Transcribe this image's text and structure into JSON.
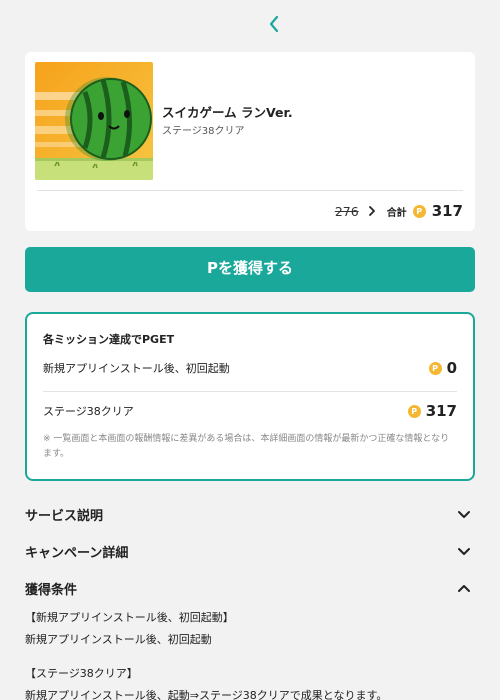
{
  "nav": {
    "back_icon": "chevron-left-icon"
  },
  "app": {
    "name": "スイカゲーム ランVer.",
    "subtitle": "ステージ38クリア",
    "old_points": "276",
    "total_label": "合計",
    "coin_glyph": "P",
    "total_points": "317"
  },
  "get_button": {
    "label": "Pを獲得する"
  },
  "missions": {
    "title": "各ミッション達成でPGET",
    "items": [
      {
        "label": "新規アプリインストール後、初回起動",
        "points": "0"
      },
      {
        "label": "ステージ38クリア",
        "points": "317"
      }
    ],
    "note": "※ 一覧画面と本画面の報酬情報に差異がある場合は、本詳細画面の情報が最新かつ正確な情報となります。"
  },
  "accordions": [
    {
      "title": "サービス説明",
      "state": "collapsed"
    },
    {
      "title": "キャンペーン詳細",
      "state": "collapsed"
    },
    {
      "title": "獲得条件",
      "state": "expanded"
    }
  ],
  "conditions": {
    "heading1": "【新規アプリインストール後、初回起動】",
    "text1": "新規アプリインストール後、初回起動",
    "heading2": "【ステージ38クリア】",
    "text2": "新規アプリインストール後、起動⇒ステージ38クリアで成果となります。"
  },
  "colors": {
    "accent": "#1aa89b",
    "coin": "#f5b731",
    "background": "#f2f2f2"
  }
}
